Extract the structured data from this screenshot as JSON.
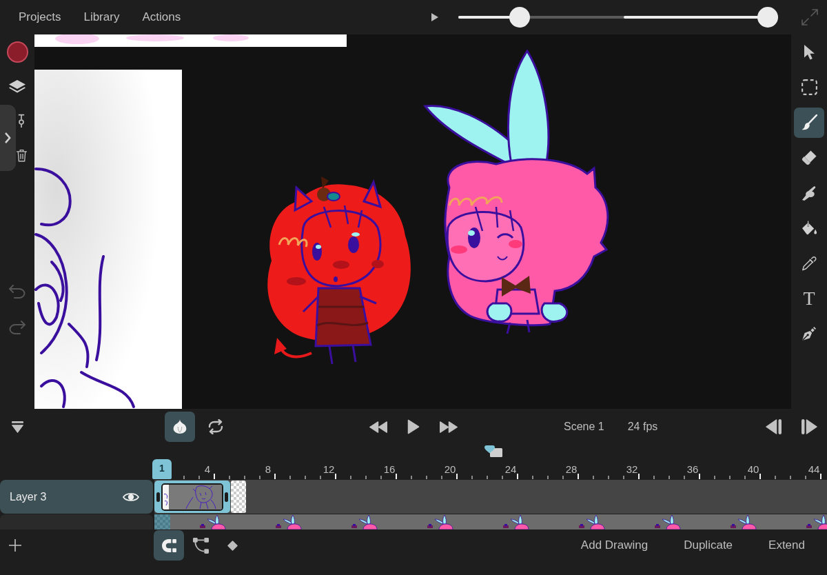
{
  "menu": [
    {
      "label": "Projects"
    },
    {
      "label": "Library"
    },
    {
      "label": "Actions"
    }
  ],
  "top_bar": {
    "sliders": [
      {
        "level": 0.35
      },
      {
        "level": 1
      }
    ]
  },
  "left_sidebar": {
    "history": [
      {
        "kind": "undo",
        "disabled": true
      },
      {
        "kind": "redo",
        "disabled": true
      }
    ]
  },
  "tools": [
    {
      "kind": "select",
      "selected": false
    },
    {
      "kind": "marquee",
      "selected": false
    },
    {
      "kind": "brush",
      "selected": true
    },
    {
      "kind": "eraser",
      "selected": false
    },
    {
      "kind": "smudge",
      "selected": false
    },
    {
      "kind": "fill",
      "selected": false
    },
    {
      "kind": "eyedropper",
      "selected": false
    },
    {
      "kind": "text",
      "label": "T",
      "selected": false
    },
    {
      "kind": "pen",
      "selected": false
    }
  ],
  "transport": {
    "toggles": [
      {
        "kind": "onion_skin",
        "on": true
      },
      {
        "kind": "loop",
        "on": false
      }
    ],
    "scene": "Scene 1",
    "fps": "24 fps"
  },
  "timeline": {
    "ruler": [
      {
        "label": "1",
        "selected": true
      },
      {
        "label": "4",
        "selected": false
      },
      {
        "label": "8",
        "selected": false
      },
      {
        "label": "12",
        "selected": false
      },
      {
        "label": "16",
        "selected": false
      },
      {
        "label": "20",
        "selected": false
      },
      {
        "label": "24",
        "selected": false
      },
      {
        "label": "28",
        "selected": false
      },
      {
        "label": "32",
        "selected": false
      },
      {
        "label": "36",
        "selected": false
      },
      {
        "label": "40",
        "selected": false
      },
      {
        "label": "44",
        "selected": false
      }
    ],
    "layers": [
      {
        "name": "Layer 3",
        "selected": true,
        "visible": true
      },
      {
        "selected": false
      }
    ]
  },
  "bottom_toolbar": {
    "modes": [
      {
        "kind": "snap",
        "on": true
      },
      {
        "kind": "motion_path",
        "on": false
      },
      {
        "kind": "keyframe",
        "on": false
      }
    ],
    "actions": [
      {
        "label": "Add Drawing"
      },
      {
        "label": "Duplicate"
      },
      {
        "label": "Extend"
      }
    ]
  }
}
